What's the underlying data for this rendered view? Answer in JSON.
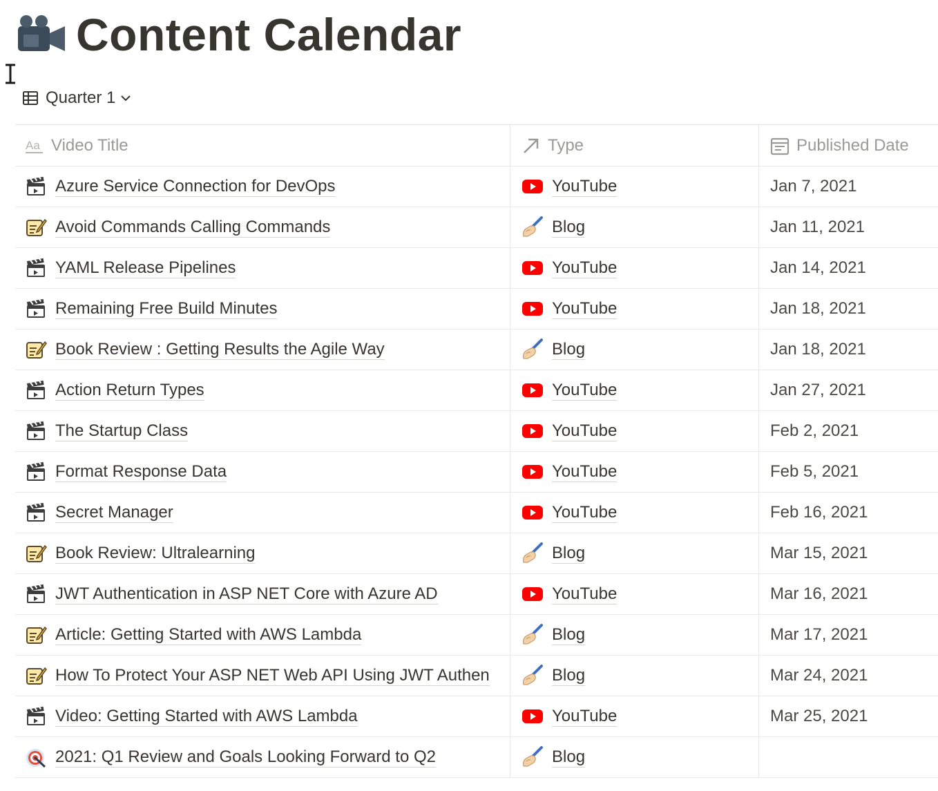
{
  "page": {
    "title": "Content Calendar",
    "icon": "video-camera-icon"
  },
  "view": {
    "label": "Quarter 1",
    "icon": "table-icon"
  },
  "columns": [
    {
      "label": "Video Title",
      "icon": "text-property-icon"
    },
    {
      "label": "Type",
      "icon": "relation-arrow-icon"
    },
    {
      "label": "Published Date",
      "icon": "calendar-icon"
    }
  ],
  "colors": {
    "youtube_red": "#ff0000",
    "text": "#37352f",
    "muted": "#9b9a97",
    "border": "#e9e9e7"
  },
  "rows": [
    {
      "icon": "clapper-board-icon",
      "title": "Azure Service Connection for DevOps",
      "type": "YouTube",
      "type_icon": "youtube-icon",
      "date": "Jan 7, 2021"
    },
    {
      "icon": "memo-icon",
      "title": "Avoid Commands Calling Commands",
      "type": "Blog",
      "type_icon": "writing-hand-icon",
      "date": "Jan 11, 2021"
    },
    {
      "icon": "clapper-board-icon",
      "title": "YAML Release Pipelines",
      "type": "YouTube",
      "type_icon": "youtube-icon",
      "date": "Jan 14, 2021"
    },
    {
      "icon": "clapper-board-icon",
      "title": "Remaining Free Build Minutes",
      "type": "YouTube",
      "type_icon": "youtube-icon",
      "date": "Jan 18, 2021"
    },
    {
      "icon": "memo-icon",
      "title": "Book Review : Getting Results the Agile Way",
      "type": "Blog",
      "type_icon": "writing-hand-icon",
      "date": "Jan 18, 2021"
    },
    {
      "icon": "clapper-board-icon",
      "title": "Action Return Types",
      "type": "YouTube",
      "type_icon": "youtube-icon",
      "date": "Jan 27, 2021"
    },
    {
      "icon": "clapper-board-icon",
      "title": "The Startup Class",
      "type": "YouTube",
      "type_icon": "youtube-icon",
      "date": "Feb 2, 2021"
    },
    {
      "icon": "clapper-board-icon",
      "title": "Format Response Data",
      "type": "YouTube",
      "type_icon": "youtube-icon",
      "date": "Feb 5, 2021"
    },
    {
      "icon": "clapper-board-icon",
      "title": "Secret Manager",
      "type": "YouTube",
      "type_icon": "youtube-icon",
      "date": "Feb 16, 2021"
    },
    {
      "icon": "memo-icon",
      "title": "Book Review: Ultralearning",
      "type": "Blog",
      "type_icon": "writing-hand-icon",
      "date": "Mar 15, 2021"
    },
    {
      "icon": "clapper-board-icon",
      "title": "JWT Authentication in ASP NET Core with Azure AD",
      "type": "YouTube",
      "type_icon": "youtube-icon",
      "date": "Mar 16, 2021"
    },
    {
      "icon": "memo-icon",
      "title": "Article: Getting Started with AWS Lambda",
      "type": "Blog",
      "type_icon": "writing-hand-icon",
      "date": "Mar 17, 2021"
    },
    {
      "icon": "memo-icon",
      "title": "How To Protect Your ASP NET Web API Using JWT Authen",
      "type": "Blog",
      "type_icon": "writing-hand-icon",
      "date": "Mar 24, 2021"
    },
    {
      "icon": "clapper-board-icon",
      "title": "Video: Getting Started with AWS Lambda",
      "type": "YouTube",
      "type_icon": "youtube-icon",
      "date": "Mar 25, 2021"
    },
    {
      "icon": "direct-hit-icon",
      "title": "2021: Q1 Review and Goals Looking Forward to Q2",
      "type": "Blog",
      "type_icon": "writing-hand-icon",
      "date": ""
    }
  ]
}
